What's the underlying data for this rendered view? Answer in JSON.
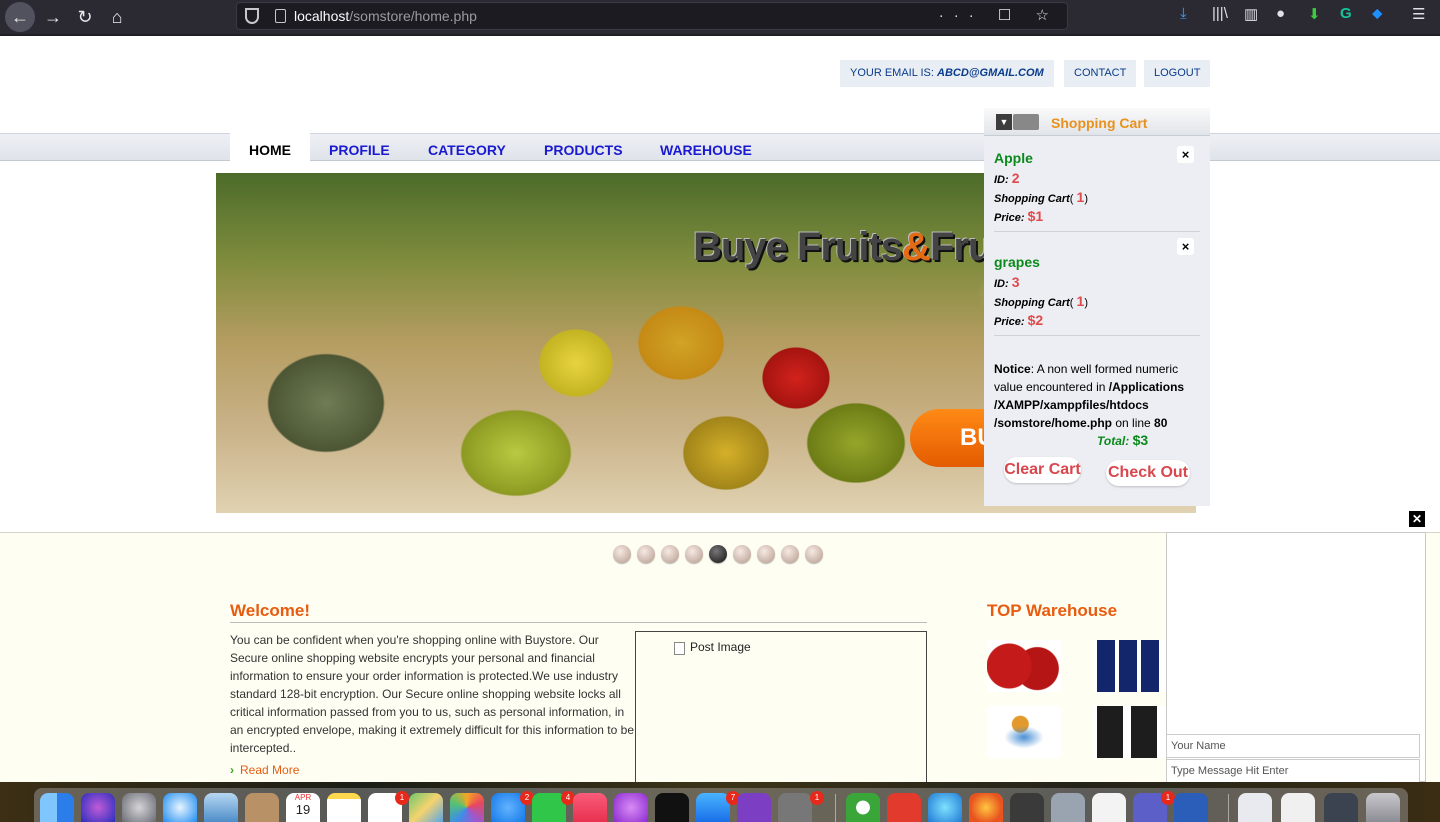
{
  "browser": {
    "url_host": "localhost",
    "url_path": "/somstore/home.php",
    "back_icon": "←",
    "forward_icon": "→",
    "reload_icon": "↻",
    "home_icon": "⌂",
    "page_actions": "··· ☐ ☆",
    "toolbar_right": [
      "⤓",
      "|||\\",
      "▥",
      "●",
      "⬇",
      "G",
      "⬥",
      "☰"
    ]
  },
  "top_links": {
    "email_label": "YOUR EMAIL IS:",
    "email_value": "ABCD@GMAIL.COM",
    "contact": "CONTACT",
    "logout": "LOGOUT"
  },
  "nav": [
    {
      "label": "HOME"
    },
    {
      "label": "PROFILE"
    },
    {
      "label": "CATEGORY"
    },
    {
      "label": "PRODUCTS"
    },
    {
      "label": "WAREHOUSE"
    }
  ],
  "banner": {
    "title_a": "Buye Fruits",
    "title_amp": "&",
    "title_b": "Frus",
    "button": "BU"
  },
  "cart": {
    "title": "Shopping Cart",
    "toggle": "▼",
    "close": "×",
    "id_label": "ID:",
    "qty_label": "Shopping Cart",
    "qty_open": "(",
    "qty_close": ")",
    "price_label": "Price:",
    "items": [
      {
        "name": "Apple",
        "id": "2",
        "qty": "1",
        "price": "$1"
      },
      {
        "name": "grapes",
        "id": "3",
        "qty": "1",
        "price": "$2"
      }
    ],
    "notice_label": "Notice",
    "notice_text": ": A non well formed numeric value encountered in ",
    "notice_path": "/Applications /XAMPP/xamppfiles/htdocs /somstore/home.php",
    "notice_line_text": " on line ",
    "notice_line": "80",
    "total_label": "Total:",
    "total_value": "$3",
    "clear_button": "Clear Cart",
    "checkout_button": "Check Out"
  },
  "slider": {
    "count": 9,
    "active_index": 4
  },
  "welcome": {
    "title": "Welcome!",
    "text": "You can be confident when you're shopping online with Buystore. Our Secure online shopping website encrypts your personal and financial information to ensure your order information is protected.We use industry standard 128-bit encryption. Our Secure online shopping website locks all critical information passed from you to us, such as personal information, in an encrypted envelope, making it extremely difficult for this information to be intercepted..",
    "read_more": "Read More",
    "read_more_icon": "›",
    "post_image_alt": "Post Image"
  },
  "top_warehouse": {
    "title": "TOP Warehouse"
  },
  "chat": {
    "close": "✕",
    "name_placeholder": "Your Name",
    "message_placeholder": "Type Message Hit Enter"
  },
  "dock": {
    "calendar_month": "APR",
    "calendar_day": "19",
    "badges": [
      "1",
      "2",
      "4",
      "7",
      "1",
      "1"
    ]
  }
}
